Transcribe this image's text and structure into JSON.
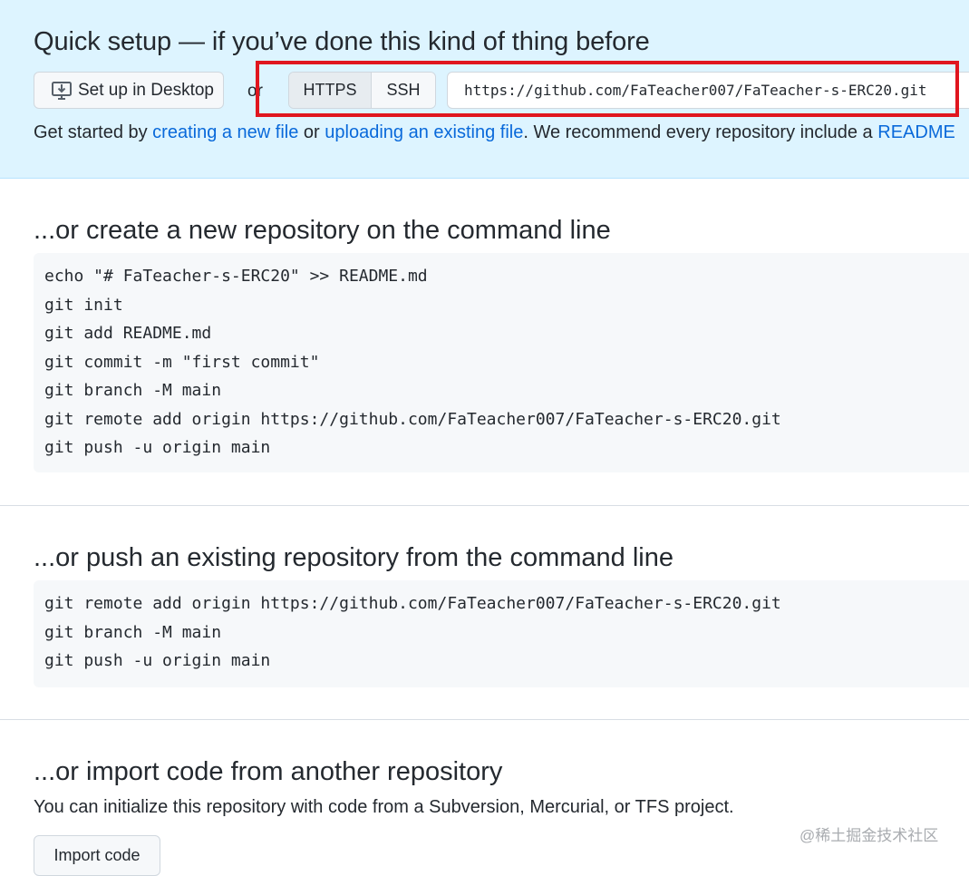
{
  "quick_setup": {
    "title": "Quick setup — if you’ve done this kind of thing before",
    "desktop_button": "Set up in Desktop",
    "or_text": "or",
    "protocols": [
      "HTTPS",
      "SSH"
    ],
    "selected_protocol": "HTTPS",
    "clone_url": "https://github.com/FaTeacher007/FaTeacher-s-ERC20.git",
    "started": {
      "prefix": "Get started by ",
      "link_new_file": "creating a new file",
      "or": " or ",
      "link_upload": "uploading an existing file",
      "suffix": ". We recommend every repository include a ",
      "link_readme": "README"
    }
  },
  "create_section": {
    "title": "...or create a new repository on the command line",
    "lines": [
      "echo \"# FaTeacher-s-ERC20\" >> README.md",
      "git init",
      "git add README.md",
      "git commit -m \"first commit\"",
      "git branch -M main",
      "git remote add origin https://github.com/FaTeacher007/FaTeacher-s-ERC20.git",
      "git push -u origin main"
    ]
  },
  "push_section": {
    "title": "...or push an existing repository from the command line",
    "lines": [
      "git remote add origin https://github.com/FaTeacher007/FaTeacher-s-ERC20.git",
      "git branch -M main",
      "git push -u origin main"
    ]
  },
  "import_section": {
    "title": "...or import code from another repository",
    "description": "You can initialize this repository with code from a Subversion, Mercurial, or TFS project.",
    "button": "Import code"
  },
  "watermark": "@稀土掘金技术社区",
  "colors": {
    "quick_bg": "#ddf4ff",
    "link": "#0969da",
    "highlight_box": "#e0161f",
    "code_bg": "#f6f8fa"
  },
  "icons": {
    "desktop_button": "desktop-download-icon"
  }
}
